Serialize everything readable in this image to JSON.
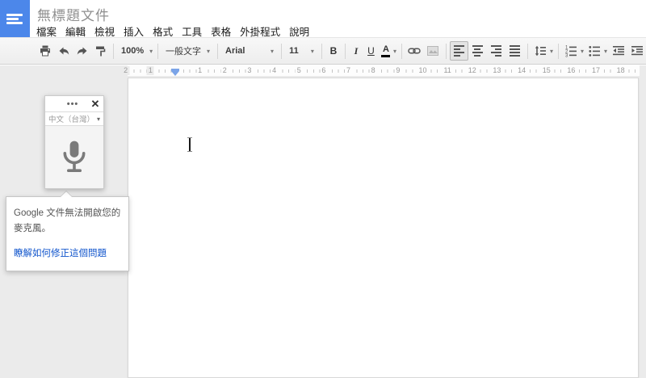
{
  "header": {
    "title": "無標題文件",
    "menu_items": [
      "檔案",
      "編輯",
      "檢視",
      "插入",
      "格式",
      "工具",
      "表格",
      "外掛程式",
      "說明"
    ]
  },
  "toolbar": {
    "zoom_value": "100%",
    "style_value": "一般文字",
    "font_value": "Arial",
    "size_value": "11",
    "bold_label": "B",
    "italic_label": "I",
    "underline_label": "U",
    "color_label": "A",
    "dropdown_arrow": "▾"
  },
  "ruler": {
    "left_numbers": [
      "2",
      "1"
    ],
    "numbers": [
      "1",
      "2",
      "3",
      "4",
      "5",
      "6",
      "7",
      "8",
      "9",
      "10",
      "11",
      "12",
      "13",
      "14",
      "15",
      "16",
      "17",
      "18"
    ]
  },
  "voice_panel": {
    "overflow_label": "•••",
    "close_label": "✕",
    "language_value": "中文（台灣）",
    "language_arrow": "▾"
  },
  "voice_tooltip": {
    "message": "Google 文件無法開啟您的麥克風。",
    "link_label": "瞭解如何修正這個問題"
  },
  "colors": {
    "logo_blue": "#4c87ea",
    "link_blue": "#1155cc",
    "marker_blue": "#7ba4e8",
    "title_gray": "#8f8f8f"
  }
}
